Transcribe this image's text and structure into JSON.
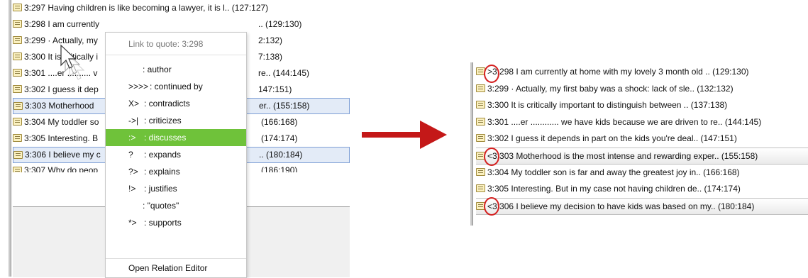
{
  "left_list": {
    "rows": [
      {
        "text": "3:297 Having children is like becoming a lawyer, it is l.. (127:127)",
        "range": ""
      },
      {
        "text": "3:298 I am currently",
        "range": ".. (129:130)"
      },
      {
        "text": "3:299 · Actually, my",
        "range": "2:132)"
      },
      {
        "text": "3:300 It is critically i",
        "range": "7:138)"
      },
      {
        "text": "3:301 ....er ..........  v",
        "range": "re.. (144:145)"
      },
      {
        "text": "3:302 I guess it dep",
        "range": "147:151)"
      },
      {
        "text": "3:303 Motherhood",
        "range": "er.. (155:158)"
      },
      {
        "text": "3:304 My toddler so",
        "range": "(166:168)"
      },
      {
        "text": "3:305 Interesting. B",
        "range": "(174:174)"
      },
      {
        "text": "3:306 I believe my c",
        "range": ".. (180:184)"
      },
      {
        "text": "3:307 Why do peop",
        "range": "(186:190)"
      }
    ]
  },
  "context_menu": {
    "header": "Link to quote: 3:298",
    "items": [
      {
        "symbol": "",
        "label": ": author"
      },
      {
        "symbol": ">>>>",
        "label": ": continued by"
      },
      {
        "symbol": "X>",
        "label": ": contradicts"
      },
      {
        "symbol": "->|",
        "label": ": criticizes"
      },
      {
        "symbol": ":>",
        "label": ": discusses"
      },
      {
        "symbol": "?",
        "label": ": expands"
      },
      {
        "symbol": "?>",
        "label": ": explains"
      },
      {
        "symbol": "!>",
        "label": ": justifies"
      },
      {
        "symbol": "",
        "label": ": \"quotes\""
      },
      {
        "symbol": "*>",
        "label": ": supports"
      }
    ],
    "footer": "Open Relation Editor",
    "highlight_color": "#6fc23a"
  },
  "right_list": {
    "rows": [
      {
        "text": ">3:298 I am currently at home with my lovely 3 month old .. (129:130)"
      },
      {
        "text": "3:299 · Actually, my first baby was a shock: lack of sle.. (132:132)"
      },
      {
        "text": "3:300 It is critically important to distinguish between .. (137:138)"
      },
      {
        "text": "3:301 ....er ............ we have kids because we are driven to re.. (144:145)"
      },
      {
        "text": "3:302 I guess it depends in part on the kids you're deal.. (147:151)"
      },
      {
        "text": "<3:303 Motherhood is the most intense and rewarding exper.. (155:158)"
      },
      {
        "text": "3:304 My toddler son is far and away the greatest joy in.. (166:168)"
      },
      {
        "text": "3:305 Interesting. But in my case not having children de.. (174:174)"
      },
      {
        "text": "<3:306 I believe my decision to have kids was based on my.. (180:184)"
      }
    ]
  },
  "colors": {
    "arrow": "#c41818",
    "circle": "#d42020",
    "selection": "#e3ebf7"
  },
  "icons": [
    "quote-icon",
    "cursor-icon",
    "arrow-icon"
  ]
}
